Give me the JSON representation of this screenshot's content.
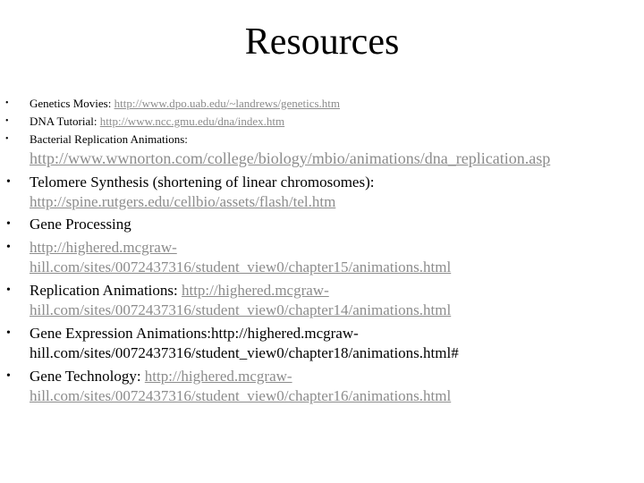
{
  "slide": {
    "title": "Resources"
  },
  "bullet_glyph": "•",
  "items": [
    {
      "label": "Genetics Movies: ",
      "link": "http://www.dpo.uab.edu/~landrews/genetics.htm"
    },
    {
      "label": "DNA Tutorial: ",
      "link": "http://www.ncc.gmu.edu/dna/index.htm"
    },
    {
      "label": "Bacterial Replication Animations:",
      "link": "http://www.wwnorton.com/college/biology/mbio/animations/dna_replication.asp"
    },
    {
      "label": "Telomere Synthesis (shortening of linear chromosomes):",
      "link": "http://spine.rutgers.edu/cellbio/assets/flash/tel.htm"
    },
    {
      "label": "Gene Processing"
    },
    {
      "link_line1": "http://highered.mcgraw-",
      "link_line2": "hill.com/sites/0072437316/student_view0/chapter15/animations.html"
    },
    {
      "label": "Replication Animations: ",
      "link_line1": "http://highered.mcgraw-",
      "link_line2": "hill.com/sites/0072437316/student_view0/chapter14/animations.html"
    },
    {
      "text_line1": "Gene Expression Animations:http://highered.mcgraw-",
      "text_line2": "hill.com/sites/0072437316/student_view0/chapter18/animations.html#"
    },
    {
      "label": "Gene Technology: ",
      "link_line1": "http://highered.mcgraw-",
      "link_line2": "hill.com/sites/0072437316/student_view0/chapter16/animations.html"
    }
  ],
  "colors": {
    "text": "#000000",
    "link": "#8c8c8c",
    "background": "#ffffff"
  }
}
